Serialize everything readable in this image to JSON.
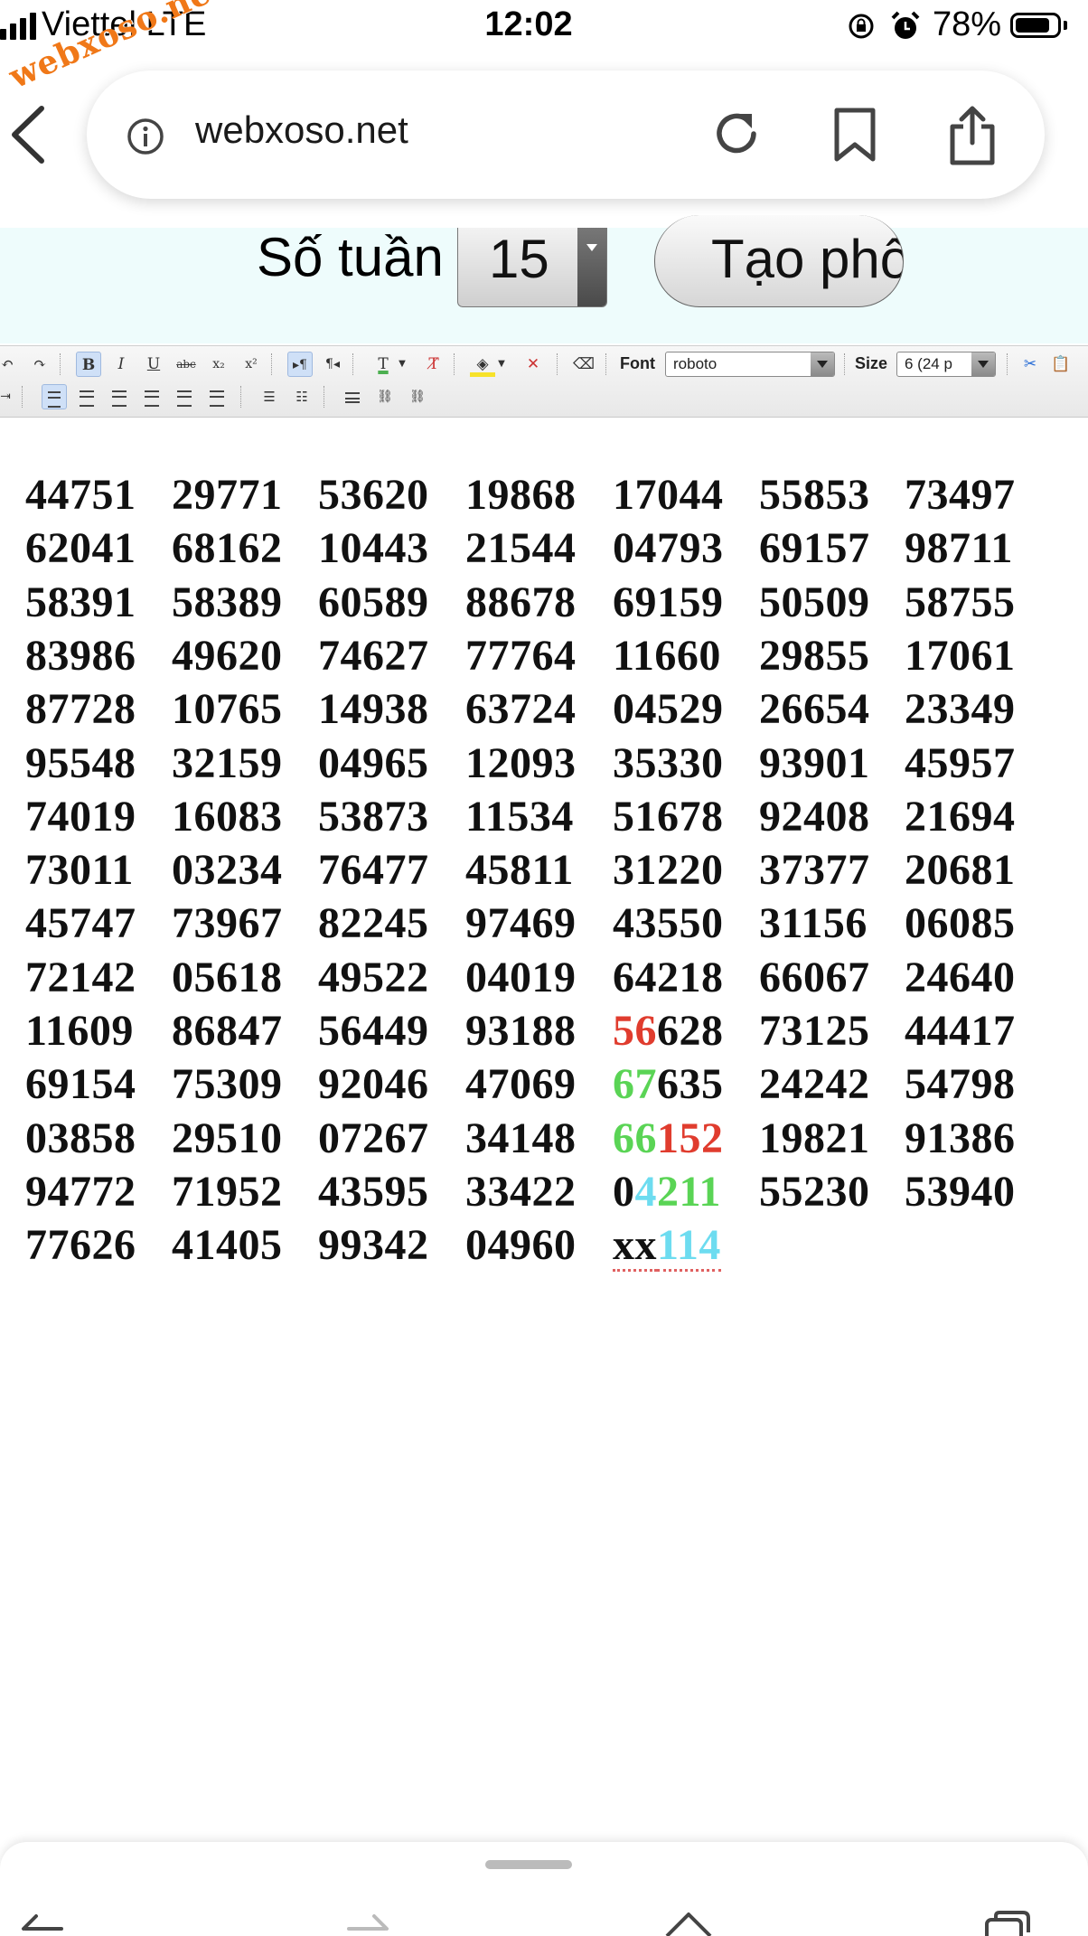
{
  "status_bar": {
    "carrier": "Viettel LTE",
    "watermark": "webxoso.net",
    "time": "12:02",
    "battery_percent": "78%",
    "battery_level": 0.78
  },
  "address_bar": {
    "url": "webxoso.net"
  },
  "form": {
    "weeks_label": "Số tuần",
    "weeks_value": "15",
    "create_button_label": "Tạo phổ"
  },
  "toolbar": {
    "font_label": "Font",
    "font_value": "roboto",
    "size_label": "Size",
    "size_value": "6 (24 p"
  },
  "numbers": [
    [
      [
        {
          "t": "44751"
        }
      ],
      [
        {
          "t": "29771"
        }
      ],
      [
        {
          "t": "53620"
        }
      ],
      [
        {
          "t": "19868"
        }
      ],
      [
        {
          "t": "17044"
        }
      ],
      [
        {
          "t": "55853"
        }
      ],
      [
        {
          "t": "73497"
        }
      ]
    ],
    [
      [
        {
          "t": "62041"
        }
      ],
      [
        {
          "t": "68162"
        }
      ],
      [
        {
          "t": "10443"
        }
      ],
      [
        {
          "t": "21544"
        }
      ],
      [
        {
          "t": "04793"
        }
      ],
      [
        {
          "t": "69157"
        }
      ],
      [
        {
          "t": "98711"
        }
      ]
    ],
    [
      [
        {
          "t": "58391"
        }
      ],
      [
        {
          "t": "58389"
        }
      ],
      [
        {
          "t": "60589"
        }
      ],
      [
        {
          "t": "88678"
        }
      ],
      [
        {
          "t": "69159"
        }
      ],
      [
        {
          "t": "50509"
        }
      ],
      [
        {
          "t": "58755"
        }
      ]
    ],
    [
      [
        {
          "t": "83986"
        }
      ],
      [
        {
          "t": "49620"
        }
      ],
      [
        {
          "t": "74627"
        }
      ],
      [
        {
          "t": "77764"
        }
      ],
      [
        {
          "t": "11660"
        }
      ],
      [
        {
          "t": "29855"
        }
      ],
      [
        {
          "t": "17061"
        }
      ]
    ],
    [
      [
        {
          "t": "87728"
        }
      ],
      [
        {
          "t": "10765"
        }
      ],
      [
        {
          "t": "14938"
        }
      ],
      [
        {
          "t": "63724"
        }
      ],
      [
        {
          "t": "04529"
        }
      ],
      [
        {
          "t": "26654"
        }
      ],
      [
        {
          "t": "23349"
        }
      ]
    ],
    [
      [
        {
          "t": "95548"
        }
      ],
      [
        {
          "t": "32159"
        }
      ],
      [
        {
          "t": "04965"
        }
      ],
      [
        {
          "t": "12093"
        }
      ],
      [
        {
          "t": "35330"
        }
      ],
      [
        {
          "t": "93901"
        }
      ],
      [
        {
          "t": "45957"
        }
      ]
    ],
    [
      [
        {
          "t": "74019"
        }
      ],
      [
        {
          "t": "16083"
        }
      ],
      [
        {
          "t": "53873"
        }
      ],
      [
        {
          "t": "11534"
        }
      ],
      [
        {
          "t": "51678"
        }
      ],
      [
        {
          "t": "92408"
        }
      ],
      [
        {
          "t": "21694"
        }
      ]
    ],
    [
      [
        {
          "t": "73011"
        }
      ],
      [
        {
          "t": "03234"
        }
      ],
      [
        {
          "t": "76477"
        }
      ],
      [
        {
          "t": "45811"
        }
      ],
      [
        {
          "t": "31220"
        }
      ],
      [
        {
          "t": "37377"
        }
      ],
      [
        {
          "t": "20681"
        }
      ]
    ],
    [
      [
        {
          "t": "45747"
        }
      ],
      [
        {
          "t": "73967"
        }
      ],
      [
        {
          "t": "82245"
        }
      ],
      [
        {
          "t": "97469"
        }
      ],
      [
        {
          "t": "43550"
        }
      ],
      [
        {
          "t": "31156"
        }
      ],
      [
        {
          "t": "06085"
        }
      ]
    ],
    [
      [
        {
          "t": "72142"
        }
      ],
      [
        {
          "t": "05618"
        }
      ],
      [
        {
          "t": "49522"
        }
      ],
      [
        {
          "t": "04019"
        }
      ],
      [
        {
          "t": "64218"
        }
      ],
      [
        {
          "t": "66067"
        }
      ],
      [
        {
          "t": "24640"
        }
      ]
    ],
    [
      [
        {
          "t": "11609"
        }
      ],
      [
        {
          "t": "86847"
        }
      ],
      [
        {
          "t": "56449"
        }
      ],
      [
        {
          "t": "93188"
        }
      ],
      [
        {
          "t": "56",
          "c": "red"
        },
        {
          "t": "628"
        }
      ],
      [
        {
          "t": "73125"
        }
      ],
      [
        {
          "t": "44417"
        }
      ]
    ],
    [
      [
        {
          "t": "69154"
        }
      ],
      [
        {
          "t": "75309"
        }
      ],
      [
        {
          "t": "92046"
        }
      ],
      [
        {
          "t": "47069"
        }
      ],
      [
        {
          "t": "67",
          "c": "green"
        },
        {
          "t": "635"
        }
      ],
      [
        {
          "t": "24242"
        }
      ],
      [
        {
          "t": "54798"
        }
      ]
    ],
    [
      [
        {
          "t": "03858"
        }
      ],
      [
        {
          "t": "29510"
        }
      ],
      [
        {
          "t": "07267"
        }
      ],
      [
        {
          "t": "34148"
        }
      ],
      [
        {
          "t": "66",
          "c": "green"
        },
        {
          "t": "152",
          "c": "red"
        }
      ],
      [
        {
          "t": "19821"
        }
      ],
      [
        {
          "t": "91386"
        }
      ]
    ],
    [
      [
        {
          "t": "94772"
        }
      ],
      [
        {
          "t": "71952"
        }
      ],
      [
        {
          "t": "43595"
        }
      ],
      [
        {
          "t": "33422"
        }
      ],
      [
        {
          "t": "0"
        },
        {
          "t": "4",
          "c": "cyan"
        },
        {
          "t": "211",
          "c": "green"
        }
      ],
      [
        {
          "t": "55230"
        }
      ],
      [
        {
          "t": "53940"
        }
      ]
    ],
    [
      [
        {
          "t": "77626"
        }
      ],
      [
        {
          "t": "41405"
        }
      ],
      [
        {
          "t": "99342"
        }
      ],
      [
        {
          "t": "04960"
        }
      ],
      [
        {
          "t": "xx",
          "u": true
        },
        {
          "t": "114",
          "c": "cyan",
          "u": true
        }
      ]
    ]
  ],
  "colors": {
    "accent_red": "#e03c2e",
    "accent_green": "#5ad455",
    "accent_cyan": "#6ddcf0",
    "form_band": "#eefcfc",
    "watermark": "#f07818"
  }
}
